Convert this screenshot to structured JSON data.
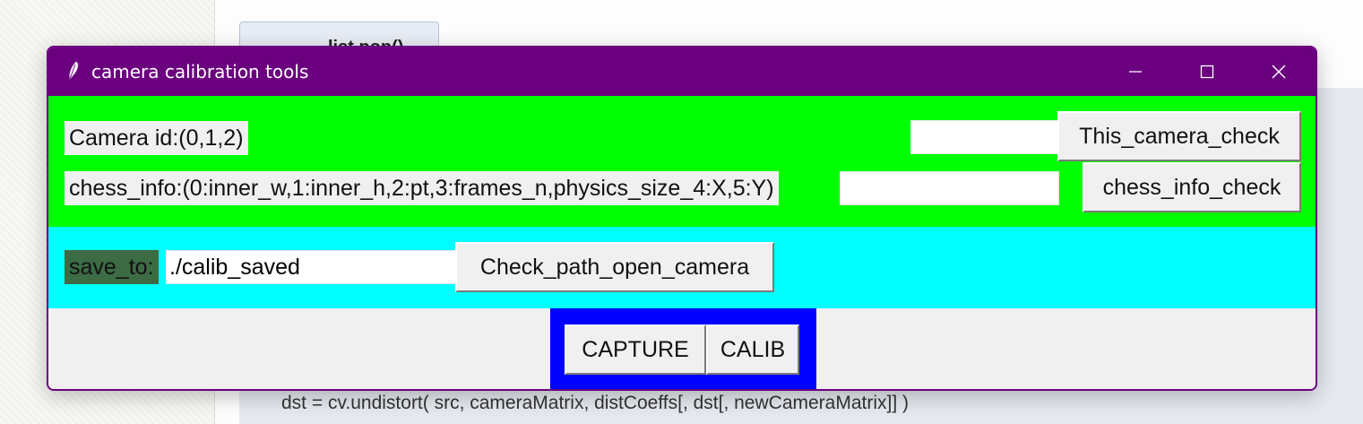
{
  "background": {
    "button_label": "list.pop()",
    "code_line": "dst = cv.undistort( src, cameraMatrix, distCoeffs[, dst[, newCameraMatrix]] )"
  },
  "window": {
    "title": "camera calibration tools",
    "title_color": "#6b007f",
    "icon": "feather-icon",
    "controls": {
      "minimize": "minimize-icon",
      "maximize": "maximize-icon",
      "close": "close-icon"
    }
  },
  "camera_row": {
    "label": "Camera id:(0,1,2)",
    "entry_value": "",
    "button": "This_camera_check",
    "bg_color": "#00ff00"
  },
  "chess_row": {
    "label": "chess_info:(0:inner_w,1:inner_h,2:pt,3:frames_n,physics_size_4:X,5:Y)",
    "entry_value": "",
    "button": "chess_info_check"
  },
  "save_row": {
    "label": "save_to:",
    "label_bg": "#3d6b43",
    "entry_value": "./calib_saved",
    "button": "Check_path_open_camera",
    "bg_color": "#00ffff"
  },
  "actions": {
    "capture": "CAPTURE",
    "calib": "CALIB",
    "frame_color": "#0000ff"
  }
}
